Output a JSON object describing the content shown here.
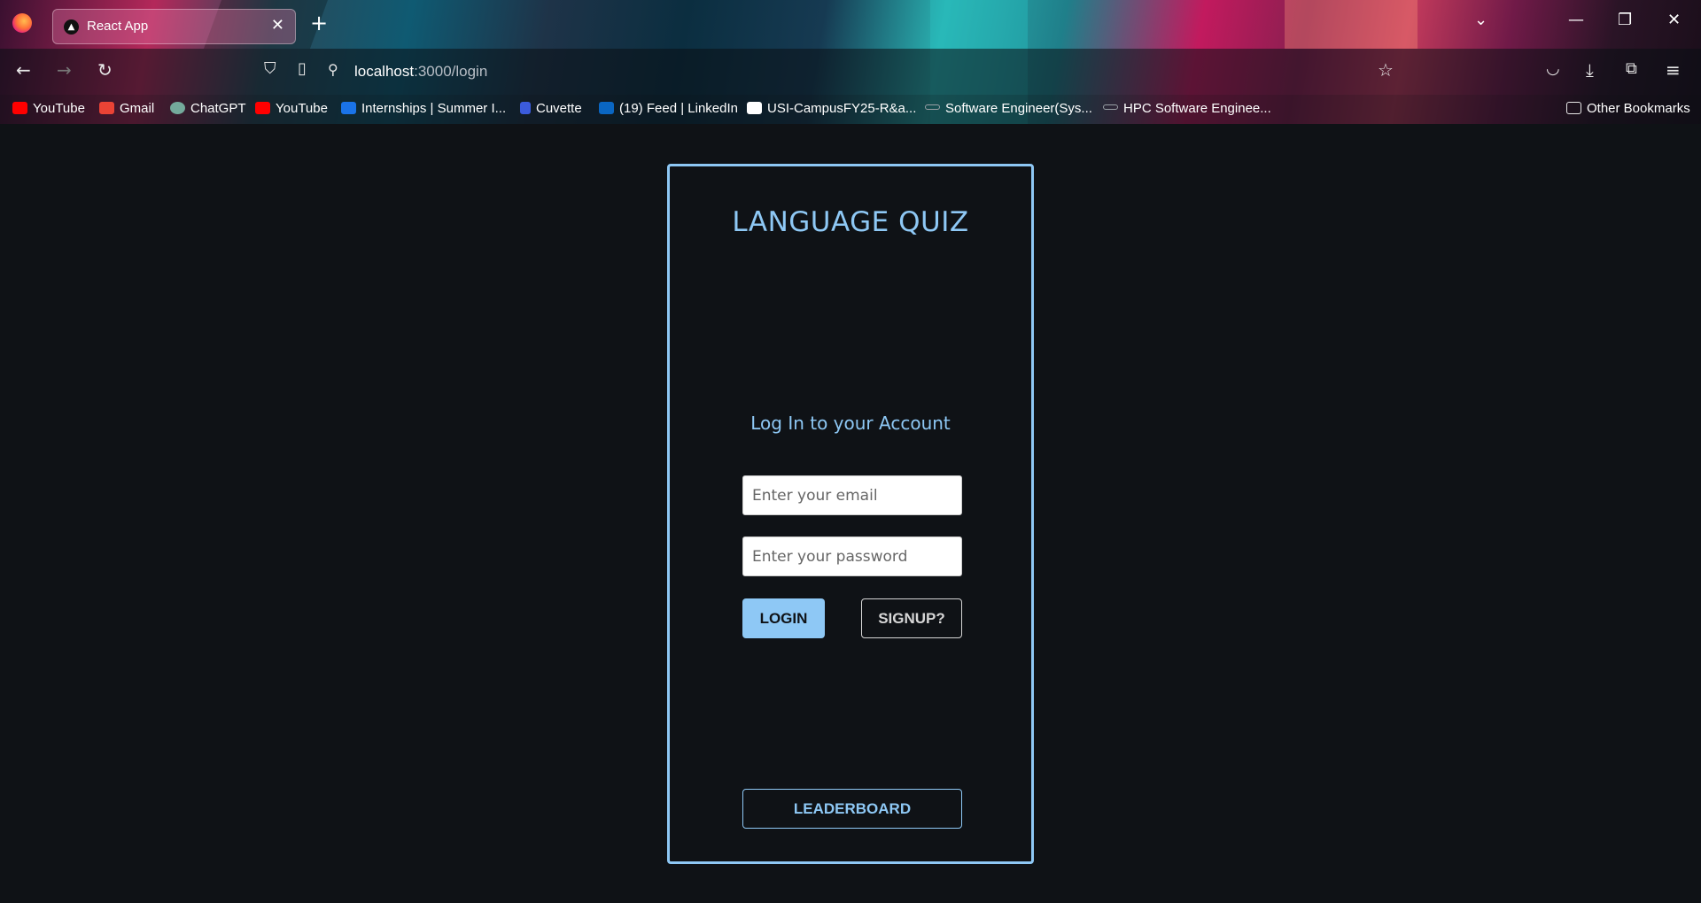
{
  "browser": {
    "tab_title": "React App",
    "url_host": "localhost",
    "url_path": ":3000/login",
    "bookmarks": [
      {
        "label": "YouTube",
        "color": "#ff0000"
      },
      {
        "label": "Gmail",
        "color": "#ea4335"
      },
      {
        "label": "ChatGPT",
        "color": "#74aa9c"
      },
      {
        "label": "YouTube",
        "color": "#ff0000"
      },
      {
        "label": "Internships | Summer I...",
        "color": "#1a73e8"
      },
      {
        "label": "Cuvette",
        "color": "#3b5bdb"
      },
      {
        "label": "(19) Feed | LinkedIn",
        "color": "#0a66c2"
      },
      {
        "label": "USI-CampusFY25-R&a...",
        "color": "#ffffff"
      },
      {
        "label": "Software Engineer(Sys...",
        "color": "#9aa0a6"
      },
      {
        "label": "HPC Software Enginee...",
        "color": "#9aa0a6"
      }
    ],
    "other_bookmarks": "Other Bookmarks"
  },
  "login": {
    "title": "LANGUAGE QUIZ",
    "subtitle": "Log In to your Account",
    "email_placeholder": "Enter your email",
    "password_placeholder": "Enter your password",
    "login_label": "LOGIN",
    "signup_label": "SIGNUP?",
    "leaderboard_label": "LEADERBOARD"
  },
  "colors": {
    "accent": "#8ec8f5",
    "background": "#0f1216"
  }
}
